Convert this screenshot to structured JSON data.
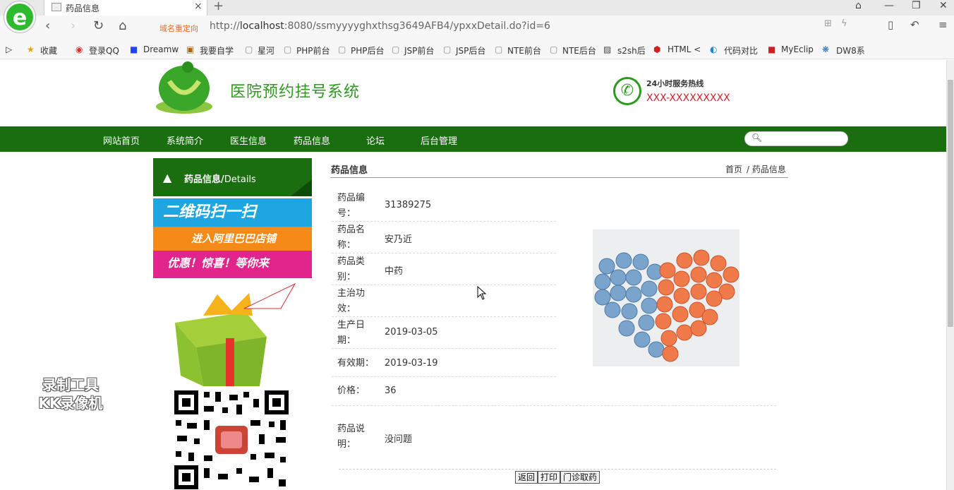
{
  "browser": {
    "tab_title": "药品信息",
    "new_tab": "+",
    "close": "×",
    "redirect_label": "域名重定向",
    "url_prefix": "http://",
    "url_host": "localhost",
    "url_rest": ":8080/ssmyyyyghxthsg3649AFB4/ypxxDetail.do?id=6",
    "bookmarks": [
      "收藏",
      "登录QQ",
      "Dreamw",
      "我要自学",
      "星河",
      "PHP前台",
      "PHP后台",
      "JSP前台",
      "JSP后台",
      "NTE前台",
      "NTE后台",
      "s2sh后",
      "HTML <",
      "代码对比",
      "MyEclip",
      "DW8系"
    ]
  },
  "header": {
    "site_title": "医院预约挂号系统",
    "hotline_label": "24小时服务热线",
    "hotline": "XXX-XXXXXXXXX"
  },
  "nav": {
    "items": [
      "网站首页",
      "系统简介",
      "医生信息",
      "药品信息",
      "论坛",
      "后台管理"
    ]
  },
  "sidebar": {
    "heading_cn": "药品信息/",
    "heading_en": "Details",
    "banner_line1": "二维码扫一扫",
    "banner_line2": "进入阿里巴巴店铺",
    "banner_line3": "优惠！惊喜！等你来"
  },
  "watermark": {
    "line1": "录制工具",
    "line2": "KK录像机"
  },
  "content": {
    "title": "药品信息",
    "breadcrumb_home": "首页",
    "breadcrumb_current": "/ 药品信息",
    "fields": [
      {
        "label": "药品编号：",
        "value": "31389275"
      },
      {
        "label": "药品名称：",
        "value": "安乃近"
      },
      {
        "label": "药品类别：",
        "value": "中药"
      },
      {
        "label": "主治功效：",
        "value": ""
      },
      {
        "label": "生产日期：",
        "value": "2019-03-05"
      },
      {
        "label": "有效期：",
        "value": "2019-03-19"
      },
      {
        "label": "价格：",
        "value": "36"
      },
      {
        "label": "药品说明：",
        "value": "没问题"
      }
    ],
    "buttons": {
      "back": "返回",
      "print": "打印",
      "take": "门诊取药"
    }
  },
  "colors": {
    "nav_green": "#1a6e10",
    "title_green": "#2c9a1d",
    "hotline_red": "#c9252b"
  }
}
